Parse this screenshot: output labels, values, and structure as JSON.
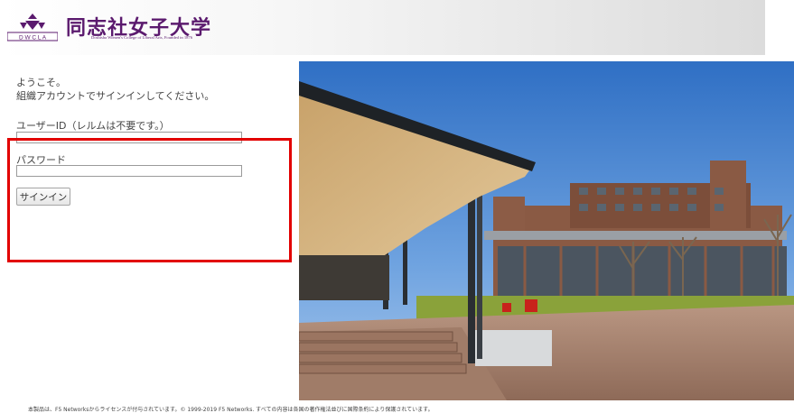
{
  "header": {
    "logo_abbrev": "D W C L A",
    "university_name": "同志社女子大学",
    "university_name_en": "Doshisha Women's College of Liberal Arts, Founded in 1876"
  },
  "login": {
    "welcome": "ようこそ。",
    "instruction": "組織アカウントでサインインしてください。",
    "username_label": "ユーザーID",
    "username_note": "（レルムは不要です。）",
    "username_value": "",
    "password_label": "パスワード",
    "password_value": "",
    "signin_label": "サインイン"
  },
  "colors": {
    "brand": "#5b1a6e",
    "highlight": "#e20000"
  },
  "footer": {
    "copyright": "本製品は、F5 Networksからライセンスが付与されています。© 1999-2019 F5 Networks. すべての内容は各国の著作権法並びに国際条約により保護されています。"
  }
}
